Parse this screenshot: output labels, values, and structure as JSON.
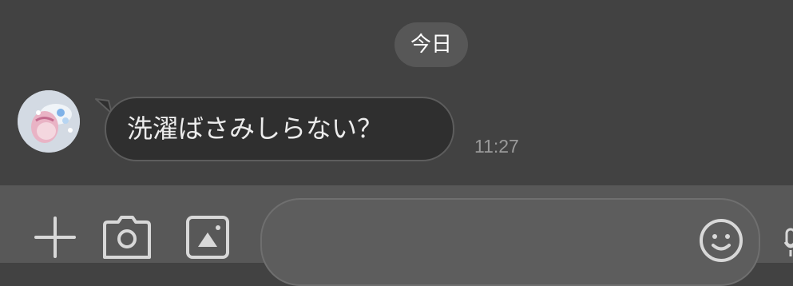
{
  "date_separator": "今日",
  "messages": [
    {
      "sender": "other",
      "avatar_icon": "avatar-icon",
      "text": "洗濯ばさみしらない？",
      "time": "11:27"
    }
  ],
  "input_bar": {
    "icons": [
      "plus-icon",
      "camera-icon",
      "image-icon",
      "emoji-icon",
      "mic-icon"
    ],
    "message_value": "",
    "message_placeholder": ""
  },
  "colors": {
    "chat_background": "#424242",
    "bubble_background": "#2f2f2f",
    "input_bar_background": "#585858",
    "timestamp": "#9a9a9a"
  }
}
